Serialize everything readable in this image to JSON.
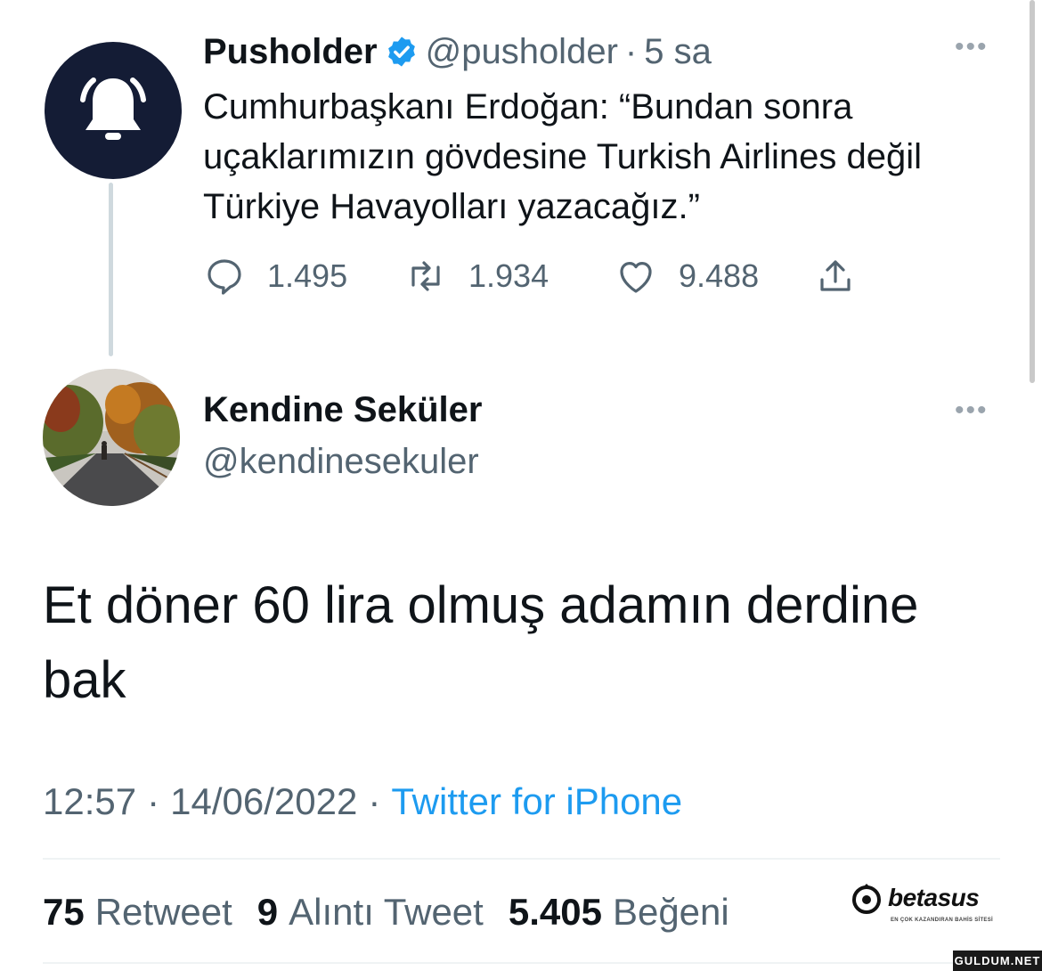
{
  "parent_tweet": {
    "author_name": "Pusholder",
    "handle": "@pusholder",
    "separator": "·",
    "time": "5 sa",
    "text": "Cumhurbaşkanı Erdoğan: “Bundan sonra uçaklarımızın gövdesine Turkish Airlines değil Türkiye Havayolları yazacağız.”",
    "replies": "1.495",
    "retweets": "1.934",
    "likes": "9.488",
    "avatar_icon": "bell-icon",
    "avatar_color": "#141c35"
  },
  "reply_tweet": {
    "author_name": "Kendine Seküler",
    "handle": "@kendinesekuler",
    "text": "Et döner 60 lira olmuş adamın derdine bak",
    "time": "12:57",
    "date": "14/06/2022",
    "separator": "·",
    "source": "Twitter for iPhone"
  },
  "stats": {
    "retweet_count": "75",
    "retweet_label": "Retweet",
    "quote_count": "9",
    "quote_label": "Alıntı Tweet",
    "like_count": "5.405",
    "like_label": "Beğeni"
  },
  "watermarks": {
    "betasus": "betasus",
    "betasus_tagline": "EN ÇOK KAZANDIRAN BAHİS SİTESİ",
    "corner": "GULDUM.NET"
  },
  "colors": {
    "link": "#1d9bf0",
    "secondary_text": "#536471",
    "verified": "#1d9bf0"
  },
  "icons": [
    "bell-icon",
    "verified-badge-icon",
    "more-icon",
    "reply-icon",
    "retweet-icon",
    "like-icon",
    "share-icon"
  ]
}
